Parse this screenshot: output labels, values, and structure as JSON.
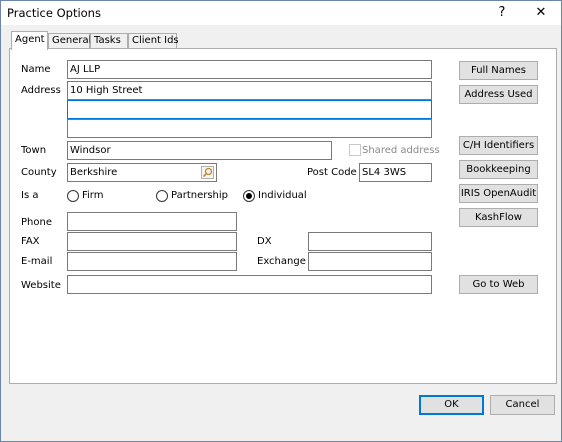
{
  "window": {
    "title": "Practice Options",
    "help": "?",
    "close": "✕"
  },
  "tabs": [
    {
      "label": "Agent"
    },
    {
      "label": "General"
    },
    {
      "label": "Tasks"
    },
    {
      "label": "Client Ids"
    }
  ],
  "form": {
    "name_label": "Name",
    "name_value": "AJ LLP",
    "address_label": "Address",
    "address_lines": [
      "10 High Street",
      "",
      ""
    ],
    "town_label": "Town",
    "town_value": "Windsor",
    "shared_address_label": "Shared address",
    "county_label": "County",
    "county_value": "Berkshire",
    "postcode_label": "Post Code",
    "postcode_value": "SL4 3WS",
    "is_a_label": "Is a",
    "radio_firm": "Firm",
    "radio_partnership": "Partnership",
    "radio_individual": "Individual",
    "selected_type": "Individual",
    "phone_label": "Phone",
    "phone_value": "",
    "fax_label": "FAX",
    "fax_value": "",
    "dx_label": "DX",
    "dx_value": "",
    "email_label": "E-mail",
    "email_value": "",
    "exchange_label": "Exchange",
    "exchange_value": "",
    "website_label": "Website",
    "website_value": ""
  },
  "side_buttons": {
    "full_names": "Full Names",
    "address_used": "Address Used",
    "ch_identifiers": "C/H Identifiers",
    "bookkeeping": "Bookkeeping",
    "iris_openaudit": "IRIS OpenAudit",
    "kashflow": "KashFlow",
    "go_to_web": "Go to Web"
  },
  "footer": {
    "ok": "OK",
    "cancel": "Cancel"
  }
}
